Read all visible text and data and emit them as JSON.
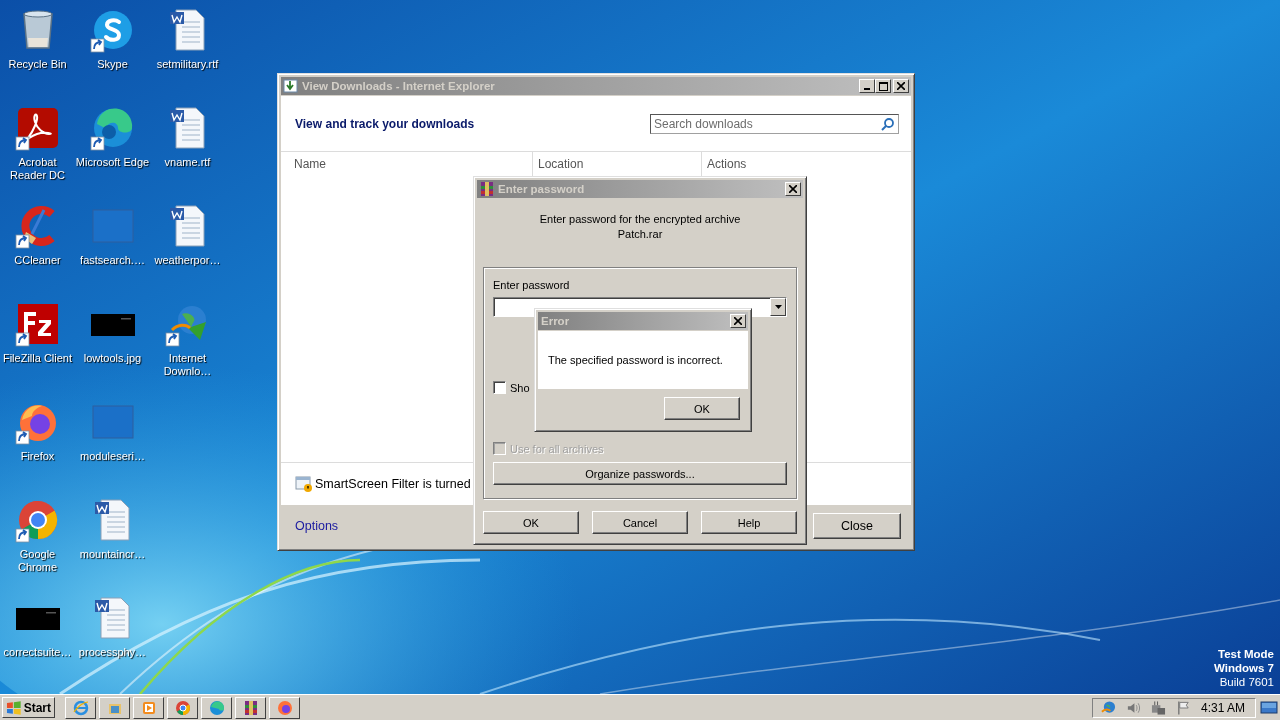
{
  "desktop": {
    "icons": [
      {
        "label": "Recycle Bin",
        "kind": "recycle",
        "shortcut": false
      },
      {
        "label": "Acrobat Reader DC",
        "kind": "acrobat",
        "shortcut": true
      },
      {
        "label": "CCleaner",
        "kind": "ccleaner",
        "shortcut": true
      },
      {
        "label": "FileZilla Client",
        "kind": "filezilla",
        "shortcut": true
      },
      {
        "label": "Firefox",
        "kind": "firefox",
        "shortcut": true
      },
      {
        "label": "Google Chrome",
        "kind": "chrome",
        "shortcut": true
      },
      {
        "label": "correctsuite…",
        "kind": "black-image",
        "shortcut": false
      },
      {
        "label": "Skype",
        "kind": "skype",
        "shortcut": true
      },
      {
        "label": "Microsoft Edge",
        "kind": "edge",
        "shortcut": true
      },
      {
        "label": "fastsearch.…",
        "kind": "blank",
        "shortcut": false
      },
      {
        "label": "lowtools.jpg",
        "kind": "black-image",
        "shortcut": false
      },
      {
        "label": "moduleseri…",
        "kind": "blank",
        "shortcut": false
      },
      {
        "label": "mountaincr…",
        "kind": "word",
        "shortcut": false
      },
      {
        "label": "processphy…",
        "kind": "word",
        "shortcut": false
      },
      {
        "label": "setmilitary.rtf",
        "kind": "word",
        "shortcut": false
      },
      {
        "label": "vname.rtf",
        "kind": "word",
        "shortcut": false
      },
      {
        "label": "weatherpor…",
        "kind": "word",
        "shortcut": false
      },
      {
        "label": "Internet Downlo…",
        "kind": "idm",
        "shortcut": true
      }
    ],
    "os_notice": [
      "Test Mode",
      "Windows 7",
      "Build 7601"
    ]
  },
  "downloads_window": {
    "title": "View Downloads - Internet Explorer",
    "heading": "View and track your downloads",
    "search": {
      "placeholder": "Search downloads"
    },
    "columns": [
      "Name",
      "Location",
      "Actions"
    ],
    "smartscreen": "SmartScreen Filter is turned",
    "options_link": "Options",
    "close_button": "Close"
  },
  "password_dialog": {
    "title": "Enter password",
    "message_lines": [
      "Enter password for the encrypted archive",
      "Patch.rar"
    ],
    "group_label": "Enter password",
    "show_checkbox": {
      "label": "Sho",
      "checked": false
    },
    "all_archives_checkbox": {
      "label": "Use for all archives",
      "checked": false,
      "disabled": true
    },
    "organize_button": "Organize passwords...",
    "buttons": [
      "OK",
      "Cancel",
      "Help"
    ]
  },
  "error_dialog": {
    "title": "Error",
    "message": "The specified password is incorrect.",
    "button": "OK"
  },
  "taskbar": {
    "start": "Start",
    "apps": [
      {
        "kind": "ie"
      },
      {
        "kind": "explorer"
      },
      {
        "kind": "media"
      },
      {
        "kind": "chrome"
      },
      {
        "kind": "edge"
      },
      {
        "kind": "winrar"
      },
      {
        "kind": "firefox"
      }
    ],
    "tray": [
      {
        "kind": "idm"
      },
      {
        "kind": "volume"
      },
      {
        "kind": "network"
      },
      {
        "kind": "flag"
      }
    ],
    "clock": "4:31 AM"
  }
}
